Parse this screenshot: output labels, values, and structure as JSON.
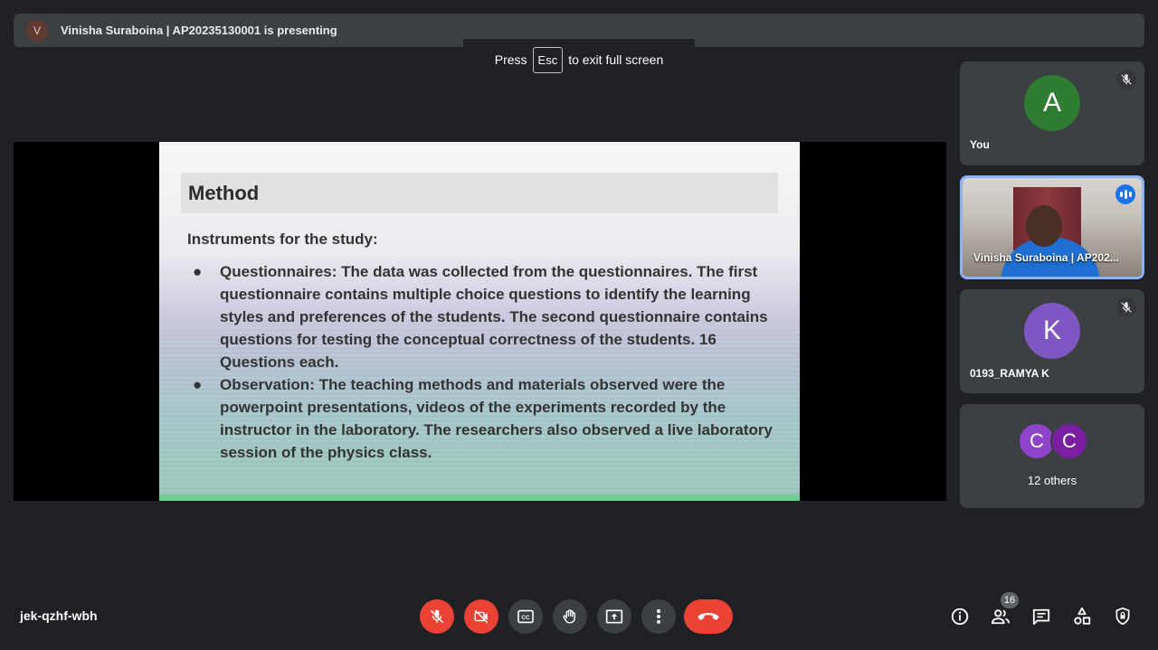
{
  "presenter": {
    "initial": "V",
    "text": "Vinisha Suraboina | AP20235130001 is presenting"
  },
  "fullscreen_hint": {
    "press": "Press",
    "key": "Esc",
    "suffix": "to exit full screen"
  },
  "slide": {
    "title": "Method",
    "subtitle": "Instruments for the study:",
    "bullets": [
      "Questionnaires: The data was collected from the questionnaires. The first questionnaire contains multiple choice questions to identify the learning styles and preferences of the students. The second questionnaire contains questions for testing the conceptual correctness of the students. 16 Questions each.",
      "Observation: The teaching methods and materials observed were the powerpoint presentations, videos of the experiments recorded by the instructor in the laboratory. The researchers also observed a live laboratory session of the physics class."
    ],
    "bullet_glyph": "●"
  },
  "participants": {
    "you": {
      "initial": "A",
      "name": "You",
      "color": "#2e7d32",
      "muted_icon": "mic-off-icon"
    },
    "vinisha": {
      "name": "Vinisha Suraboina | AP202...",
      "speaking_icon": "speaking-icon"
    },
    "ramya": {
      "initial": "K",
      "name": "0193_RAMYA K",
      "color": "#7e57c2",
      "muted_icon": "mic-off-icon"
    },
    "others": {
      "initials": [
        "C",
        "C"
      ],
      "colors": [
        "#8e44c9",
        "#7b1fa2"
      ],
      "label": "12 others"
    }
  },
  "meeting_code": "jek-qzhf-wbh",
  "controls": {
    "mic": "mic-off-icon",
    "camera": "camera-off-icon",
    "captions": "captions-icon",
    "hand": "raise-hand-icon",
    "present": "present-screen-icon",
    "more": "more-options-icon",
    "leave": "hang-up-icon",
    "colors": {
      "danger": "#ea4335",
      "neutral": "#3c4043"
    }
  },
  "right_panel": {
    "info": "info-icon",
    "people": "people-icon",
    "people_count": "16",
    "chat": "chat-icon",
    "activities": "activities-icon",
    "host_controls": "shield-lock-icon"
  }
}
